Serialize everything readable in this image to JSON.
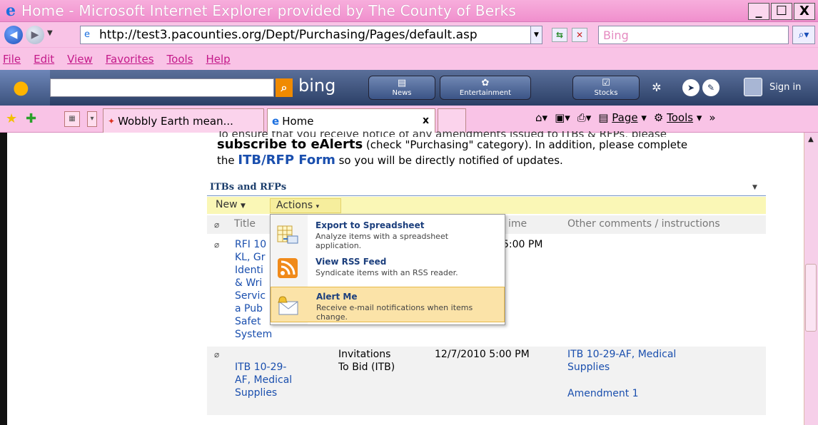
{
  "window": {
    "title": "Home - Microsoft Internet Explorer provided by The County of Berks",
    "buttons": [
      "_",
      "☐",
      "X"
    ]
  },
  "address": {
    "url": "http://test3.pacounties.org/Dept/Purchasing/Pages/default.asp",
    "search_value": "Bing"
  },
  "menu": [
    "File",
    "Edit",
    "View",
    "Favorites",
    "Tools",
    "Help"
  ],
  "bing_toolbar": {
    "logo": "bing",
    "buttons": [
      "News",
      "Entertainment",
      "Stocks"
    ],
    "sign_in": "Sign in"
  },
  "tabs": [
    {
      "label": "Wobbly Earth mean..."
    },
    {
      "label": "Home",
      "close": "x"
    }
  ],
  "commands": {
    "page": "Page",
    "tools": "Tools"
  },
  "content": {
    "intro_clipped": "To ensure that you receive notice of any amendments issued to ITBs & RFPs, please",
    "subscribe": "subscribe to eAlerts",
    "check_text": " (check \"Purchasing\" category).  In addition, please complete",
    "the": "the ",
    "form_link": "ITB/RFP Form",
    "notify_text": " so you will be directly notified of updates."
  },
  "webpart": {
    "title": "ITBs and RFPs",
    "new_label": "New",
    "actions_label": "Actions",
    "columns": [
      "Title",
      "ime",
      "Other comments / instructions"
    ]
  },
  "rows": [
    {
      "title_lines": [
        "RFI 10",
        "KL, Gr",
        "Identi",
        "& Wri",
        "Servic",
        "a Pub",
        "Safet",
        "System"
      ],
      "time": "5:00 PM"
    },
    {
      "title_lines": [
        "ITB 10-29-",
        "AF, Medical",
        "Supplies"
      ],
      "type_lines": [
        "Invitations",
        "To Bid (ITB)"
      ],
      "time": "12/7/2010 5:00 PM",
      "comments_lines": [
        "ITB 10-29-AF, Medical",
        "Supplies"
      ],
      "amendment": "Amendment 1"
    }
  ],
  "actions_menu": [
    {
      "title": "Export to Spreadsheet",
      "desc": "Analyze items with a spreadsheet application.",
      "icon": "spreadsheet-icon"
    },
    {
      "title": "View RSS Feed",
      "desc": "Syndicate items with an RSS reader.",
      "icon": "rss-icon"
    },
    {
      "title": "Alert Me",
      "desc": "Receive e-mail notifications when items change.",
      "icon": "alert-icon",
      "highlighted": true
    }
  ]
}
